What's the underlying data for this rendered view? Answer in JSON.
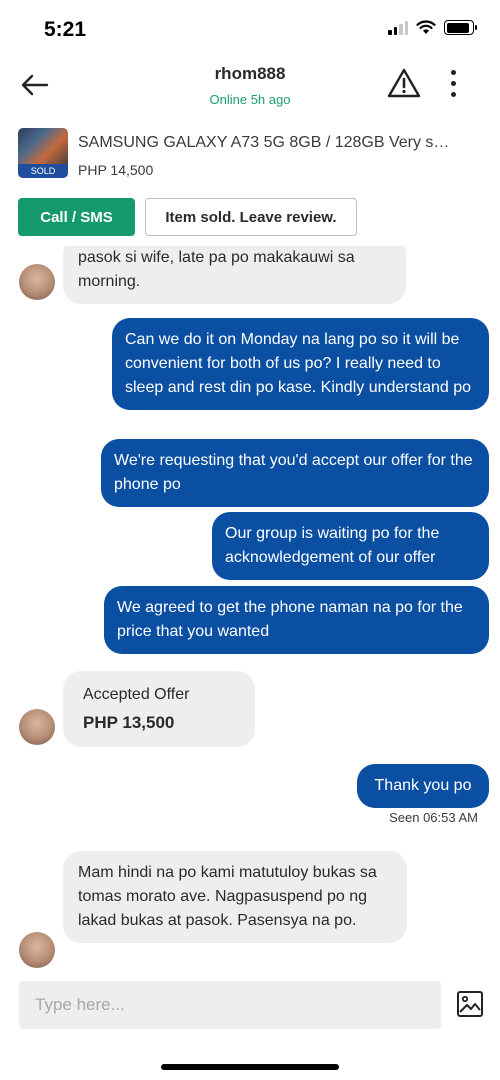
{
  "status_bar": {
    "time": "5:21"
  },
  "header": {
    "username": "rhom888",
    "online_status": "Online 5h ago"
  },
  "listing": {
    "title": "SAMSUNG GALAXY A73 5G 8GB / 128GB Very s…",
    "price": "PHP 14,500",
    "badge": "SOLD"
  },
  "actions": {
    "call": "Call / SMS",
    "review": "Item sold. Leave review."
  },
  "messages": {
    "m1": "pasok si wife, late pa po makakauwi sa morning.",
    "m2": "Can we do it on Monday na lang po so it will be convenient for both of us po? I really need to sleep and rest din po kase. Kindly understand po",
    "m3": "We're requesting that you'd accept our offer for the phone po",
    "m4": "Our group is waiting po for the acknowledgement of our offer",
    "m5": "We agreed to get the phone naman na po for the price that you wanted",
    "offer_label": "Accepted Offer",
    "offer_price": "PHP 13,500",
    "m6": "Thank you po",
    "seen": "Seen 06:53 AM",
    "m7": "Mam hindi na po kami matutuloy bukas sa tomas morato ave. Nagpasuspend po ng lakad bukas at pasok. Pasensya na po."
  },
  "composer": {
    "placeholder": "Type here..."
  },
  "colors": {
    "accent_green": "#159a6e",
    "outgoing_bubble": "#0b4fa2",
    "incoming_bubble": "#eeeeee",
    "online_text": "#1a9e72"
  }
}
